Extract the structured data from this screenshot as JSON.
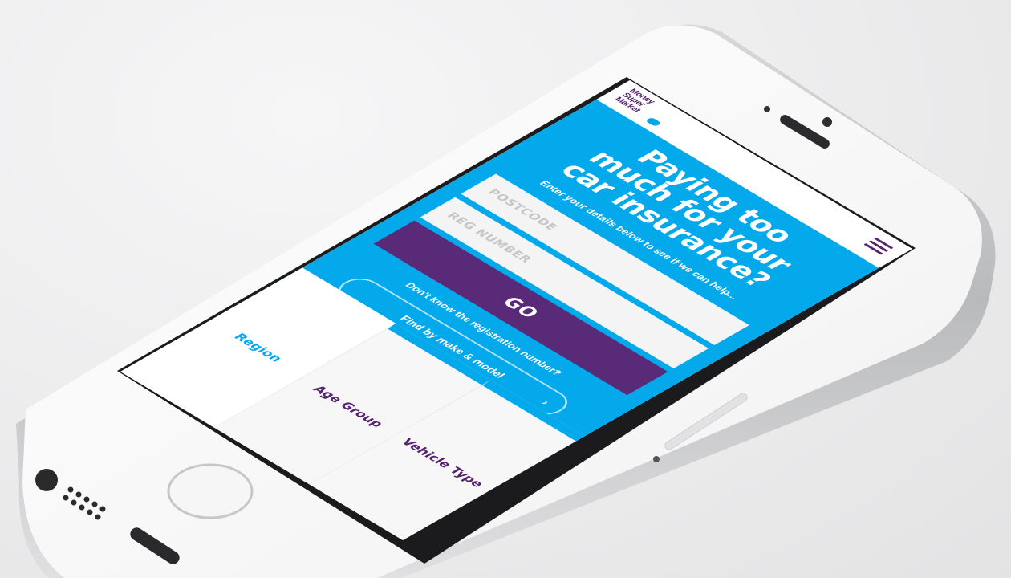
{
  "app": {
    "brand": {
      "line1": "Money",
      "line2": "Super",
      "line3": "Market"
    }
  },
  "hero": {
    "headline_line1": "Paying too",
    "headline_line2": "much for your",
    "headline_line3": "car insurance?",
    "subline": "Enter your details below to see if we can help..."
  },
  "form": {
    "postcode_placeholder": "POSTCODE",
    "reg_placeholder": "REG NUMBER",
    "go_label": "GO",
    "dont_know": "Don't know the registration number?",
    "find_label": "Find by make & model",
    "find_chevron": "›"
  },
  "tabs": [
    {
      "label": "Region",
      "state": "active"
    },
    {
      "label": "Age Group",
      "state": "inactive"
    },
    {
      "label": "Vehicle Type",
      "state": "inactive"
    }
  ],
  "colors": {
    "brand_blue": "#04a9ec",
    "brand_purple": "#582a77",
    "background": "#ececed"
  },
  "icons": {
    "menu": "hamburger-menu-icon",
    "home": "home-button",
    "chevron": "chevron-right-icon"
  }
}
